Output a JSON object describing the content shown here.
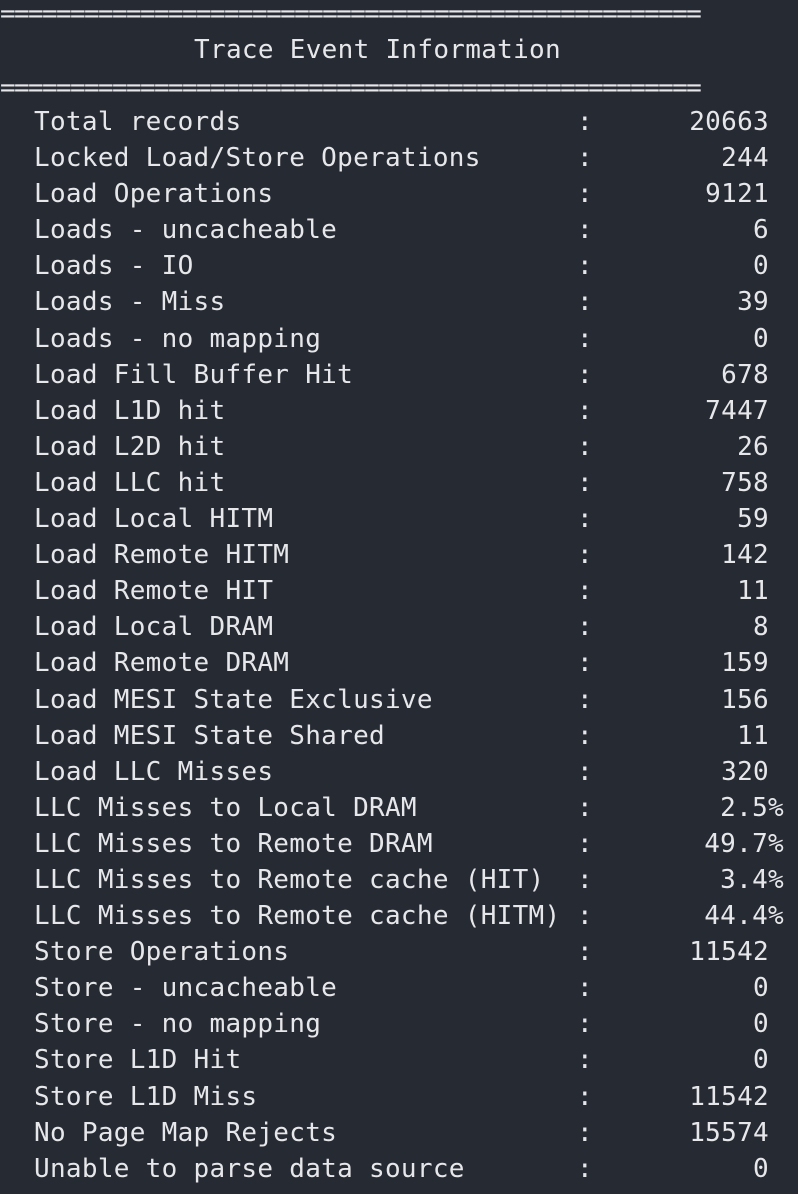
{
  "header": {
    "rule": "==================================================",
    "title": "Trace Event Information"
  },
  "rows": [
    {
      "label": "Total records",
      "sep": ":",
      "value": "20663"
    },
    {
      "label": "Locked Load/Store Operations",
      "sep": ":",
      "value": "244"
    },
    {
      "label": "Load Operations",
      "sep": ":",
      "value": "9121"
    },
    {
      "label": "Loads - uncacheable",
      "sep": ":",
      "value": "6"
    },
    {
      "label": "Loads - IO",
      "sep": ":",
      "value": "0"
    },
    {
      "label": "Loads - Miss",
      "sep": ":",
      "value": "39"
    },
    {
      "label": "Loads - no mapping",
      "sep": ":",
      "value": "0"
    },
    {
      "label": "Load Fill Buffer Hit",
      "sep": ":",
      "value": "678"
    },
    {
      "label": "Load L1D hit",
      "sep": ":",
      "value": "7447"
    },
    {
      "label": "Load L2D hit",
      "sep": ":",
      "value": "26"
    },
    {
      "label": "Load LLC hit",
      "sep": ":",
      "value": "758"
    },
    {
      "label": "Load Local HITM",
      "sep": ":",
      "value": "59"
    },
    {
      "label": "Load Remote HITM",
      "sep": ":",
      "value": "142"
    },
    {
      "label": "Load Remote HIT",
      "sep": ":",
      "value": "11"
    },
    {
      "label": "Load Local DRAM",
      "sep": ":",
      "value": "8"
    },
    {
      "label": "Load Remote DRAM",
      "sep": ":",
      "value": "159"
    },
    {
      "label": "Load MESI State Exclusive",
      "sep": ":",
      "value": "156"
    },
    {
      "label": "Load MESI State Shared",
      "sep": ":",
      "value": "11"
    },
    {
      "label": "Load LLC Misses",
      "sep": ":",
      "value": "320"
    },
    {
      "label": "LLC Misses to Local DRAM",
      "sep": ":",
      "value": "2.5%"
    },
    {
      "label": "LLC Misses to Remote DRAM",
      "sep": ":",
      "value": "49.7%"
    },
    {
      "label": "LLC Misses to Remote cache (HIT)",
      "sep": ":",
      "value": "3.4%"
    },
    {
      "label": "LLC Misses to Remote cache (HITM)",
      "sep": ":",
      "value": "44.4%"
    },
    {
      "label": "Store Operations",
      "sep": ":",
      "value": "11542"
    },
    {
      "label": "Store - uncacheable",
      "sep": ":",
      "value": "0"
    },
    {
      "label": "Store - no mapping",
      "sep": ":",
      "value": "0"
    },
    {
      "label": "Store L1D Hit",
      "sep": ":",
      "value": "0"
    },
    {
      "label": "Store L1D Miss",
      "sep": ":",
      "value": "11542"
    },
    {
      "label": "No Page Map Rejects",
      "sep": ":",
      "value": "15574"
    },
    {
      "label": "Unable to parse data source",
      "sep": ":",
      "value": "0"
    }
  ]
}
